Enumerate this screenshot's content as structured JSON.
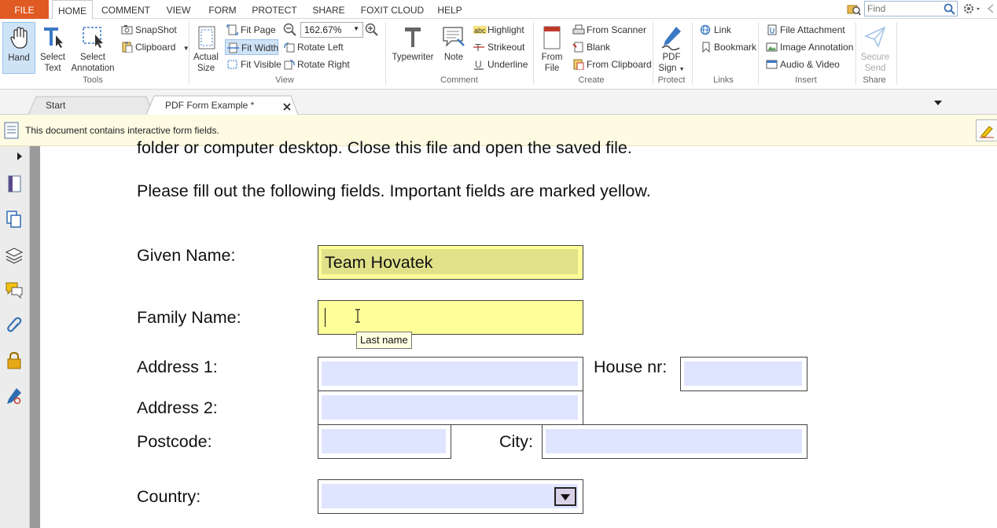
{
  "menubar": {
    "tabs": [
      "FILE",
      "HOME",
      "COMMENT",
      "VIEW",
      "FORM",
      "PROTECT",
      "SHARE",
      "FOXIT CLOUD",
      "HELP"
    ],
    "find_placeholder": "Find"
  },
  "ribbon": {
    "tools": {
      "hand": "Hand",
      "select_text_1": "Select",
      "select_text_2": "Text",
      "select_annot_1": "Select",
      "select_annot_2": "Annotation",
      "snapshot": "SnapShot",
      "clipboard": "Clipboard",
      "label": "Tools"
    },
    "view": {
      "actual_1": "Actual",
      "actual_2": "Size",
      "fit_page": "Fit Page",
      "fit_width": "Fit Width",
      "fit_visible": "Fit Visible",
      "zoom": "162.67%",
      "rotate_left": "Rotate Left",
      "rotate_right": "Rotate Right",
      "label": "View"
    },
    "comment": {
      "typewriter": "Typewriter",
      "note": "Note",
      "highlight": "Highlight",
      "strikeout": "Strikeout",
      "underline": "Underline",
      "label": "Comment"
    },
    "create": {
      "from_file_1": "From",
      "from_file_2": "File",
      "from_scanner": "From Scanner",
      "blank": "Blank",
      "from_clipboard": "From Clipboard",
      "label": "Create"
    },
    "protect": {
      "pdf_sign_1": "PDF",
      "pdf_sign_2": "Sign",
      "label": "Protect"
    },
    "links": {
      "link": "Link",
      "bookmark": "Bookmark",
      "label": "Links"
    },
    "insert": {
      "file_attachment": "File Attachment",
      "image_annotation": "Image Annotation",
      "audio_video": "Audio & Video",
      "label": "Insert"
    },
    "share": {
      "secure_1": "Secure",
      "secure_2": "Send",
      "label": "Share"
    }
  },
  "doc_tabs": [
    "Start",
    "PDF Form Example *"
  ],
  "infobar": {
    "message": "This document contains interactive form fields."
  },
  "document": {
    "line_partial": "folder or computer desktop. Close this file and open the saved file.",
    "instructions": "Please fill out the following fields. Important fields are marked yellow.",
    "given_name_label": "Given Name:",
    "given_name_value": "Team Hovatek",
    "family_name_label": "Family Name:",
    "family_name_value": "",
    "tooltip": "Last name",
    "address1_label": "Address 1:",
    "house_nr_label": "House nr:",
    "address2_label": "Address 2:",
    "postcode_label": "Postcode:",
    "city_label": "City:",
    "country_label": "Country:"
  },
  "colors": {
    "file_tab": "#e05a23",
    "required_field": "#ffff99",
    "optional_field": "#dfe5ff"
  }
}
